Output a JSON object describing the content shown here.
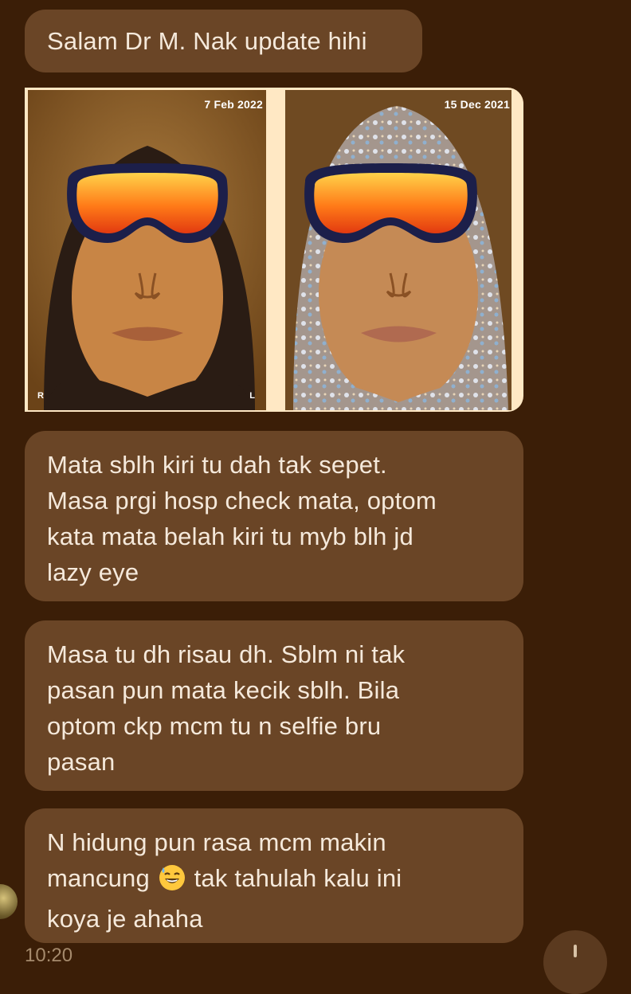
{
  "messages": [
    {
      "id": "m1",
      "lines": [
        "Salam Dr M. Nak update hihi"
      ]
    },
    {
      "id": "m3",
      "lines": [
        "Mata sblh kiri tu dah tak sepet.",
        "Masa prgi hosp check mata, optom",
        "kata mata belah kiri tu myb blh jd",
        "lazy eye"
      ]
    },
    {
      "id": "m4",
      "lines": [
        "Masa tu dh risau dh. Sblm ni tak",
        "pasan pun mata kecik sblh. Bila",
        "optom ckp mcm tu n selfie bru",
        "pasan"
      ]
    },
    {
      "id": "m5",
      "lines": [
        "N hidung pun rasa mcm makin",
        "mancung",
        "tak tahulah kalu ini",
        "koya je ahaha"
      ],
      "emoji": "sweat-smile-emoji"
    }
  ],
  "photo": {
    "left_date": "7 Feb 2022",
    "right_date": "15 Dec 2021",
    "left_marker": "R",
    "right_marker": "L",
    "overlay": "ski-goggles-sticker"
  },
  "timestamp": "10:20",
  "colors": {
    "background": "#3b1e07",
    "bubble": "#6a4526",
    "text": "#f5e9db",
    "photo_frame": "#ffe8c4"
  }
}
